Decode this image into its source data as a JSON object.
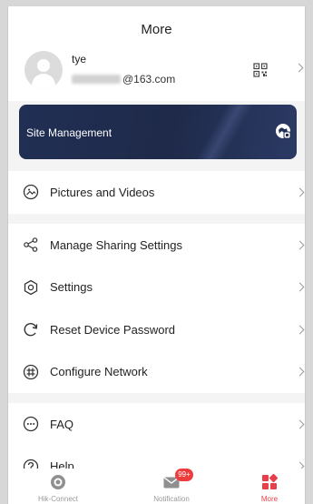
{
  "header": {
    "title": "More"
  },
  "profile": {
    "username": "tye",
    "email_suffix": "@163.com"
  },
  "site_management": {
    "label": "Site Management"
  },
  "section1": [
    {
      "label": "Pictures and Videos",
      "icon": "pictures-icon"
    }
  ],
  "section2": [
    {
      "label": "Manage Sharing Settings",
      "icon": "share-icon"
    },
    {
      "label": "Settings",
      "icon": "settings-icon"
    },
    {
      "label": "Reset Device Password",
      "icon": "reset-icon"
    },
    {
      "label": "Configure Network",
      "icon": "network-icon"
    }
  ],
  "section3": [
    {
      "label": "FAQ",
      "icon": "faq-icon"
    },
    {
      "label": "Help",
      "icon": "help-icon"
    }
  ],
  "tabbar": {
    "tabs": [
      {
        "label": "Hik-Connect",
        "icon": "hik-connect-icon"
      },
      {
        "label": "Notification",
        "icon": "mail-icon",
        "badge": "99+"
      },
      {
        "label": "More",
        "icon": "more-grid-icon"
      }
    ],
    "active_color": "#e8404a"
  }
}
